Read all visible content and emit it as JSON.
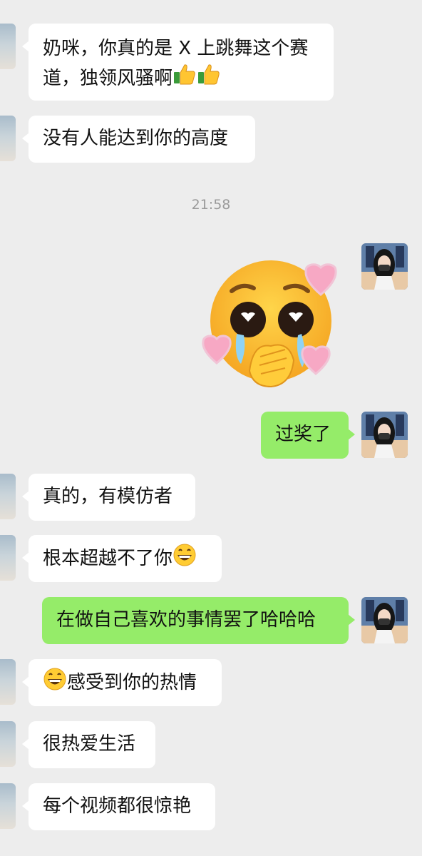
{
  "timestamp": "21:58",
  "messages": [
    {
      "side": "in",
      "line1": "奶咪，你真的是 X 上跳舞这个赛",
      "line2": "道，独领风骚啊",
      "emoji": "thumbs-up-icon"
    },
    {
      "side": "in",
      "text": "没有人能达到你的高度"
    },
    {
      "side": "out",
      "sticker": "pleading-face-hands-over-mouth-with-hearts"
    },
    {
      "side": "out",
      "text": "过奖了"
    },
    {
      "side": "in",
      "text": "真的，有模仿者"
    },
    {
      "side": "in",
      "text": "根本超越不了你",
      "emoji": "grinning-face-icon"
    },
    {
      "side": "out",
      "text": "在做自己喜欢的事情罢了哈哈哈"
    },
    {
      "side": "in",
      "text": "感受到你的热情",
      "emoji": "grinning-face-icon"
    },
    {
      "side": "in",
      "text": "很热爱生活"
    },
    {
      "side": "in",
      "text": "每个视频都很惊艳"
    }
  ],
  "colors": {
    "background": "#ededed",
    "incoming": "#ffffff",
    "outgoing": "#95ec69",
    "timestamp": "#9a9a9a"
  }
}
